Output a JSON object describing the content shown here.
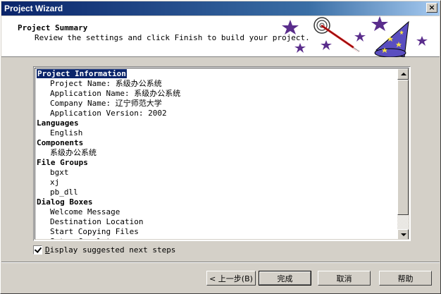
{
  "window": {
    "title": "Project Wizard",
    "close_label": "×"
  },
  "header": {
    "title": "Project Summary",
    "subtitle": "Review the settings and click Finish to build your project."
  },
  "summary": {
    "sections": [
      {
        "label": "Project Information",
        "selected": true,
        "items": [
          "Project Name:  系级办公系统",
          "Application Name:  系级办公系统",
          "Company Name:  辽宁师范大学",
          "Application Version:  2002"
        ]
      },
      {
        "label": "Languages",
        "items": [
          "English"
        ]
      },
      {
        "label": "Components",
        "items": [
          "系级办公系统"
        ]
      },
      {
        "label": "File Groups",
        "items": [
          "bgxt",
          "xj",
          "pb_dll"
        ]
      },
      {
        "label": "Dialog Boxes",
        "items": [
          "Welcome Message",
          "Destination Location",
          "Start Copying Files",
          "Setup Complete"
        ]
      }
    ]
  },
  "checkbox": {
    "label_prefix": "",
    "label_underlined": "D",
    "label_rest": "isplay suggested next steps",
    "checked": true
  },
  "buttons": {
    "back": "< 上一步(B)",
    "finish": "完成",
    "cancel": "取消",
    "help": "帮助"
  },
  "colors": {
    "titlebar_start": "#0a246a",
    "titlebar_end": "#a6caf0",
    "selection": "#0a246a",
    "star": "#5a2d8c",
    "face": "#d4d0c8"
  },
  "icons": [
    "close-icon",
    "wizard-wand-icon",
    "wizard-hat-icon",
    "star-icon",
    "scroll-up-icon",
    "scroll-down-icon",
    "check-icon"
  ]
}
